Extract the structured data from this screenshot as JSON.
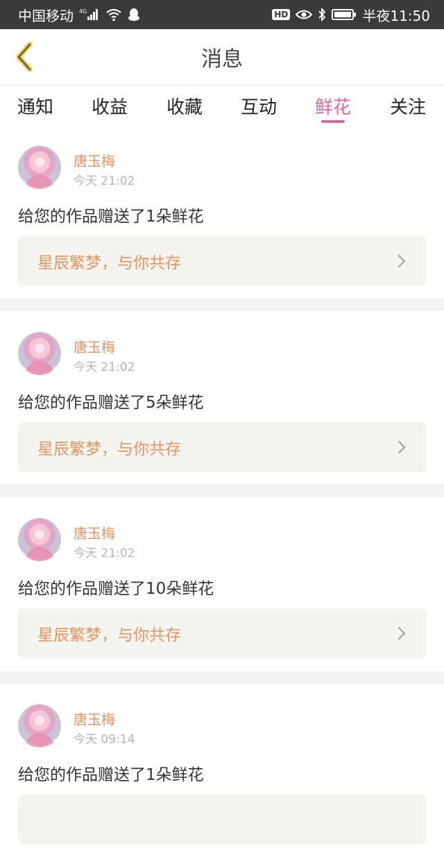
{
  "status_bar": {
    "carrier": "中国移动",
    "network": "4G",
    "time": "半夜11:50",
    "hd_label": "HD",
    "icons": [
      "signal-icon",
      "wifi-icon",
      "qq-penguin-icon",
      "hd-icon",
      "eye-icon",
      "bluetooth-icon",
      "battery-icon"
    ]
  },
  "header": {
    "title": "消息",
    "back_icon": "chevron-left-icon"
  },
  "tabs": [
    {
      "label": "通知"
    },
    {
      "label": "收益"
    },
    {
      "label": "收藏"
    },
    {
      "label": "互动"
    },
    {
      "label": "鲜花",
      "active": true
    },
    {
      "label": "关注"
    }
  ],
  "messages": [
    {
      "user": "唐玉梅",
      "time": "今天 21:02",
      "text": "给您的作品赠送了1朵鲜花",
      "work_title": "星辰繁梦，与你共存"
    },
    {
      "user": "唐玉梅",
      "time": "今天 21:02",
      "text": "给您的作品赠送了5朵鲜花",
      "work_title": "星辰繁梦，与你共存"
    },
    {
      "user": "唐玉梅",
      "time": "今天 21:02",
      "text": "给您的作品赠送了10朵鲜花",
      "work_title": "星辰繁梦，与你共存"
    },
    {
      "user": "唐玉梅",
      "time": "今天 09:14",
      "text": "给您的作品赠送了1朵鲜花",
      "work_title": ""
    }
  ],
  "colors": {
    "accent": "#e066a0",
    "name_orange": "#e8935e",
    "status_bar_bg": "#3a3a3a",
    "card_bg": "#f5f5ef",
    "separator": "#f4f4f4"
  }
}
